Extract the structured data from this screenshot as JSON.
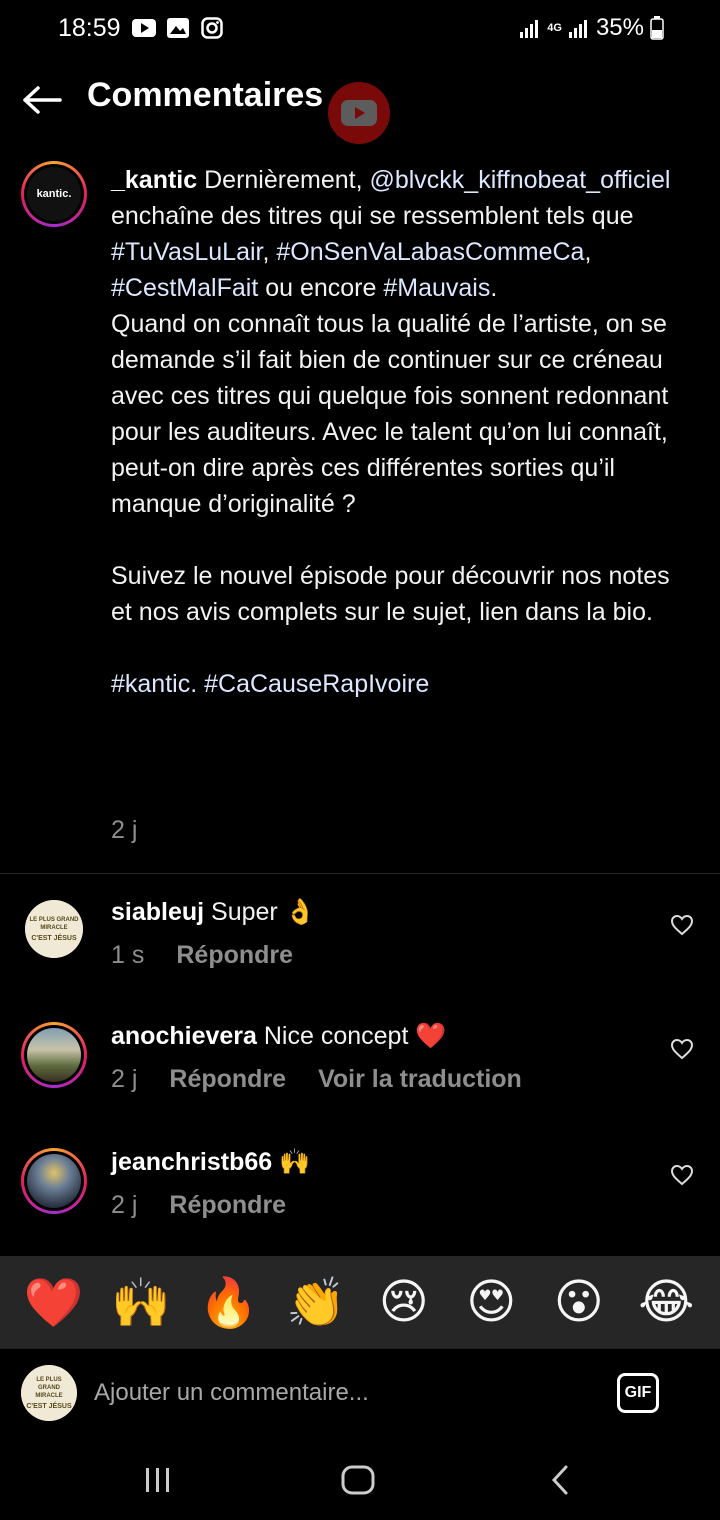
{
  "status_bar": {
    "time": "18:59",
    "battery": "35%",
    "network": "4G"
  },
  "header": {
    "title": "Commentaires"
  },
  "caption": {
    "username": "_kantic",
    "avatar_text": "kantic.",
    "segments": [
      {
        "type": "text",
        "value": " Dernièrement, "
      },
      {
        "type": "mention",
        "value": "@blvckk_kiffnobeat_officiel"
      },
      {
        "type": "text",
        "value": " enchaîne des titres qui se ressemblent tels que "
      },
      {
        "type": "tag",
        "value": "#TuVasLuLair"
      },
      {
        "type": "text",
        "value": ", "
      },
      {
        "type": "tag",
        "value": "#OnSenVaLabasCommeCa"
      },
      {
        "type": "text",
        "value": ", "
      },
      {
        "type": "tag",
        "value": "#CestMalFait"
      },
      {
        "type": "text",
        "value": " ou encore "
      },
      {
        "type": "tag",
        "value": "#Mauvais"
      },
      {
        "type": "text",
        "value": ".\nQuand on connaît tous la qualité de l’artiste, on se demande s’il fait bien de continuer sur ce créneau avec ces titres qui quelque fois sonnent redonnant pour les auditeurs. Avec le talent qu’on lui connaît, peut-on dire après ces différentes sorties qu’il manque d’originalité ?\n\nSuivez le nouvel épisode pour découvrir nos notes et nos avis complets sur le sujet, lien dans la bio.\n\n"
      },
      {
        "type": "tag",
        "value": "#kantic."
      },
      {
        "type": "text",
        "value": " "
      },
      {
        "type": "tag",
        "value": "#CaCauseRapIvoire"
      }
    ],
    "time": "2 j"
  },
  "comments": [
    {
      "username": "siableuj",
      "text": "Super 👌",
      "time": "1 s",
      "reply": "Répondre",
      "translate": ""
    },
    {
      "username": "anochievera",
      "text": "Nice concept ❤️",
      "time": "2 j",
      "reply": "Répondre",
      "translate": "Voir la traduction"
    },
    {
      "username": "jeanchristb66",
      "text": "🙌",
      "time": "2 j",
      "reply": "Répondre",
      "translate": ""
    }
  ],
  "avatar_texts": {
    "jesus_top": "LE PLUS GRAND MIRACLE",
    "jesus_mid": "C'EST JÉSUS"
  },
  "emoji_bar": [
    "❤️",
    "🙌",
    "🔥",
    "👏",
    "😢",
    "😍",
    "😮",
    "😂"
  ],
  "input": {
    "placeholder": "Ajouter un commentaire...",
    "gif_label": "GIF"
  },
  "colors": {
    "background": "#000000",
    "muted_text": "#8e8e8e",
    "emoji_bar_bg": "#262626",
    "link": "#dce7ff"
  }
}
